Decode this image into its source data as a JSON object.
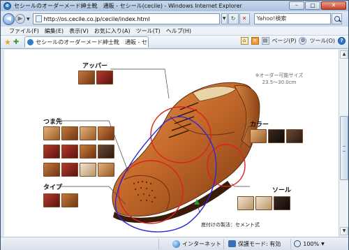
{
  "window": {
    "title": "セシールのオーダーメード紳士靴　通販 - セシール(cecile) - Windows Internet Explorer",
    "min": "–",
    "max": "□",
    "close": "✕"
  },
  "address": {
    "url": "http://os.cecile.co.jp/cecile/index.html",
    "search_text": "Yahoo!検索"
  },
  "menu": [
    "ファイル(F)",
    "編集(E)",
    "表示(V)",
    "お気に入り(A)",
    "ツール(T)",
    "ヘルプ(H)"
  ],
  "tab": {
    "label": "セシールのオーダーメード紳士靴　通販 - セシ..."
  },
  "commands": {
    "page": "ページ(P)",
    "tools": "ツール(O)"
  },
  "status": {
    "zone": "インターネット",
    "protected": "保護モード: 有効",
    "zoom": "100%"
  },
  "page": {
    "upper_label": "アッパー",
    "toe_label": "つま先",
    "type_label": "タイプ",
    "color_label": "カラー",
    "sole_label": "ソール",
    "order_size_line1": "※オーダー可能サイズ",
    "order_size_line2": "23.5～30.0cm",
    "sole_method": "底付けの製法：セメント式"
  },
  "colors": {
    "accent_red": "#e02020",
    "accent_blue": "#2a2ad8",
    "leather": "#b8632a"
  }
}
